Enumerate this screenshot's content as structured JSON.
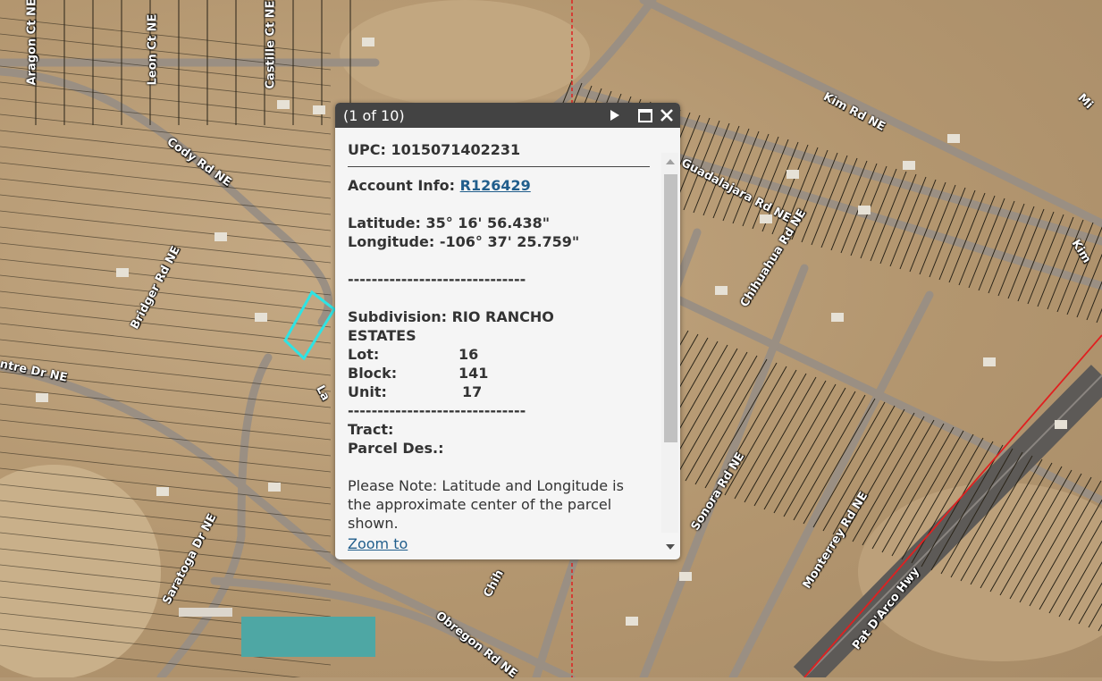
{
  "map": {
    "colors": {
      "terrain": "#b59a76",
      "parcel_lines": "#2a2418",
      "roads": "#9a8f83",
      "highway": "#5d5a57",
      "selected_parcel": "#2fe3e3",
      "boundary": "#e02020"
    },
    "road_labels": [
      {
        "text": "Aragon Ct NE"
      },
      {
        "text": "Leon Ct NE"
      },
      {
        "text": "Castille Ct NE"
      },
      {
        "text": "Cody Rd NE"
      },
      {
        "text": "Bridger Rd NE"
      },
      {
        "text": "ntre Dr NE"
      },
      {
        "text": "Kim Rd NE"
      },
      {
        "text": "Guadalajara Rd NE"
      },
      {
        "text": "Chihuahua Rd NE"
      },
      {
        "text": "Sonora Rd NE"
      },
      {
        "text": "Monterrey Rd NE"
      },
      {
        "text": "Pat D'Arco Hwy"
      },
      {
        "text": "Saratoga Dr NE"
      },
      {
        "text": "Obregon Rd NE"
      },
      {
        "text": "Kim"
      },
      {
        "text": "Mi"
      },
      {
        "text": "Chih"
      },
      {
        "text": "La"
      }
    ]
  },
  "popup": {
    "title": "(1 of 10)",
    "icons": [
      "play-icon",
      "maximize-icon",
      "close-icon"
    ],
    "upc_label": "UPC:",
    "upc_value": "1015071402231",
    "account_label": "Account Info:",
    "account_value": "R126429",
    "latitude_label": "Latitude:",
    "latitude_value": "35° 16' 56.438\"",
    "longitude_label": "Longitude:",
    "longitude_value": "-106° 37' 25.759\"",
    "separator": "------------------------------",
    "subdivision_label": "Subdivision:",
    "subdivision_value_1": "RIO RANCHO",
    "subdivision_value_2": "ESTATES",
    "lot_label": "Lot:",
    "lot_value": "16",
    "block_label": "Block:",
    "block_value": "141",
    "unit_label": "Unit:",
    "unit_value": "17",
    "tract_label": "Tract:",
    "parcel_des_label": "Parcel Des.:",
    "note_line_1": "Please Note: Latitude and Longitude is",
    "note_line_2": "the approximate center of the parcel",
    "note_line_3": "shown.",
    "zoom_link": "Zoom to"
  }
}
